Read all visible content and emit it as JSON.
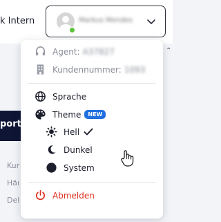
{
  "app": {
    "name": "k Intern"
  },
  "user": {
    "name": "Markus Mendes"
  },
  "background": {
    "panel_text": "port-",
    "items": [
      "Kur",
      "Häı",
      "Del"
    ]
  },
  "menu": {
    "agent_label": "Agent:",
    "agent_value": "A37827",
    "customer_label": "Kundennummer:",
    "customer_value": "1093",
    "language_label": "Sprache",
    "theme_label": "Theme",
    "theme_badge": "NEW",
    "theme_options": [
      {
        "label": "Hell",
        "icon": "sun-icon",
        "selected": true
      },
      {
        "label": "Dunkel",
        "icon": "moon-icon",
        "selected": false
      },
      {
        "label": "System",
        "icon": "circle-icon",
        "selected": false
      }
    ],
    "logout_label": "Abmelden"
  },
  "colors": {
    "accent": "#1f6fe0",
    "danger": "#e0301e",
    "presence": "#5bc23a",
    "dark_panel": "#0e1535"
  }
}
